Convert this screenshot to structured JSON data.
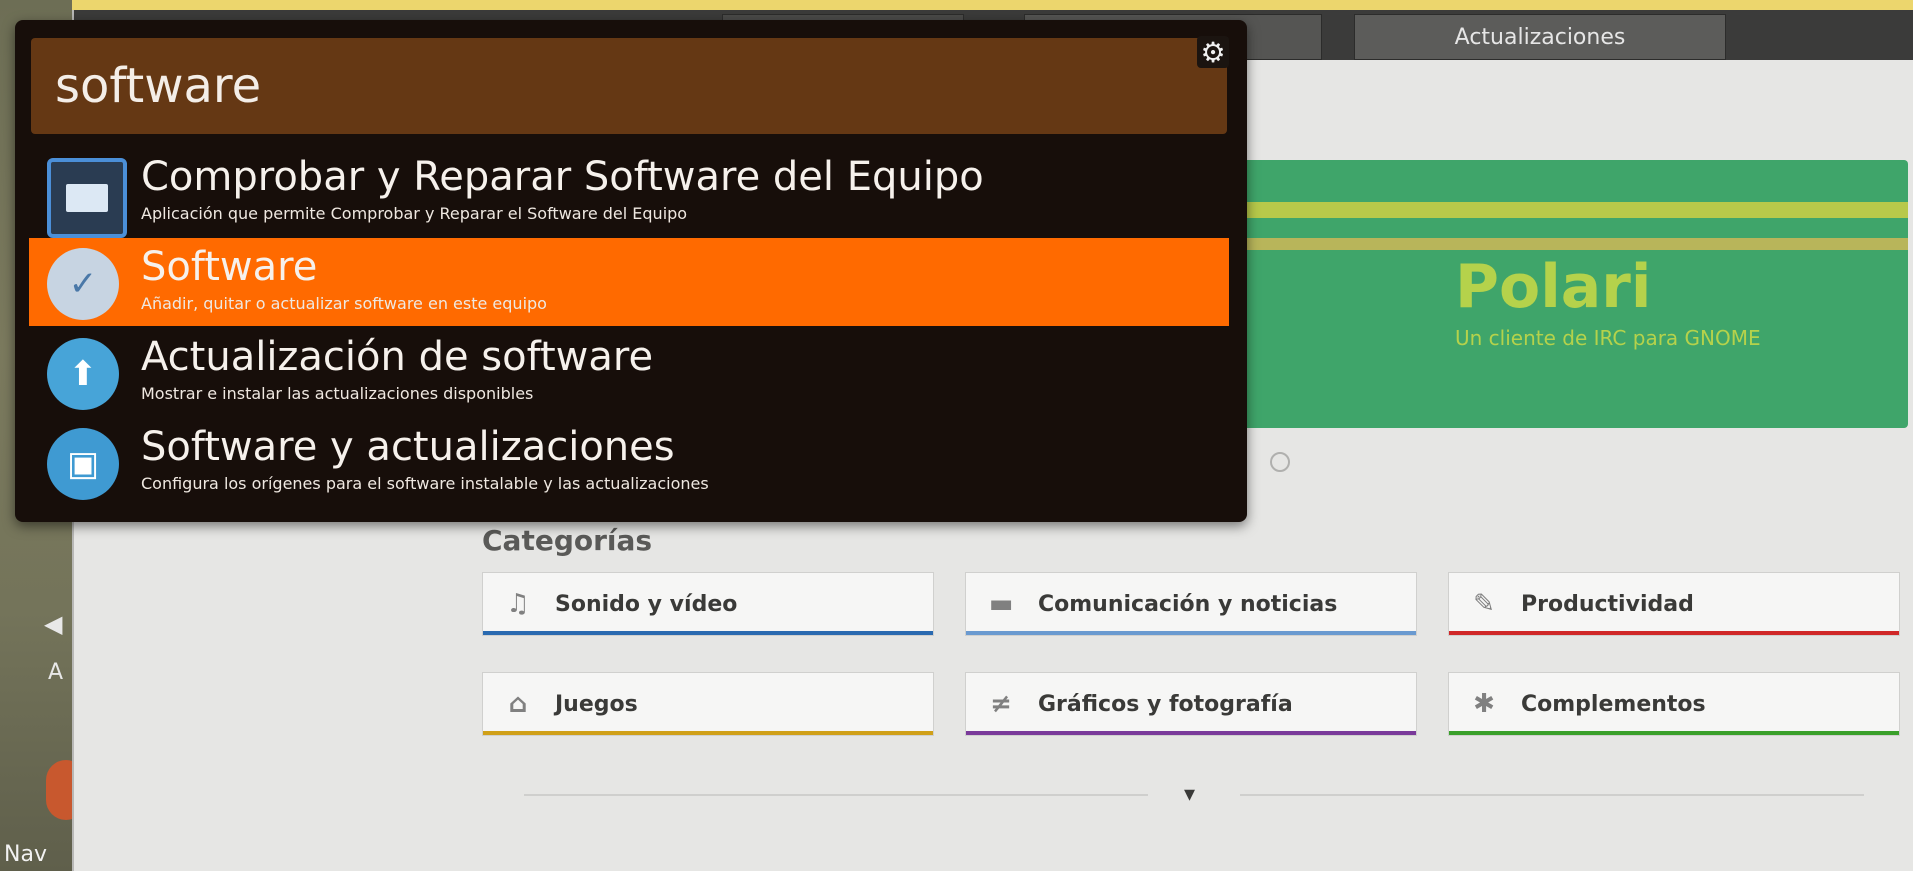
{
  "dash": {
    "search": {
      "value": "software",
      "settings_icon": "gear-icon"
    },
    "results": [
      {
        "title": "Comprobar y Reparar Software del Equipo",
        "description": "Aplicación que permite Comprobar y Reparar el Software del Equipo",
        "icon": "monitor-check-icon",
        "selected": false
      },
      {
        "title": "Software",
        "description": "Añadir, quitar o actualizar software en este equipo",
        "icon": "software-bag-icon",
        "selected": true
      },
      {
        "title": "Actualización de software",
        "description": "Mostrar e instalar las actualizaciones disponibles",
        "icon": "update-arrow-icon",
        "selected": false
      },
      {
        "title": "Software y actualizaciones",
        "description": "Configura los orígenes para el software instalable y las actualizaciones",
        "icon": "software-box-icon",
        "selected": false
      }
    ],
    "colors": {
      "background": "#170e0a",
      "search_background": "#653814",
      "selection": "#ff6a00"
    }
  },
  "window": {
    "tabs": [
      "Actualizaciones"
    ],
    "featured": {
      "title": "Polari",
      "subtitle": "Un cliente de IRC para GNOME",
      "color": "#3fa56a"
    },
    "categories_heading": "Categorías",
    "categories": [
      {
        "label": "Sonido y vídeo",
        "icon": "music-note-icon",
        "color": "#2a6ab0"
      },
      {
        "label": "Comunicación y noticias",
        "icon": "chat-bubble-icon",
        "color": "#6a9ad0"
      },
      {
        "label": "Productividad",
        "icon": "edit-icon",
        "color": "#d02828"
      },
      {
        "label": "Juegos",
        "icon": "gamepad-icon",
        "color": "#d0a018"
      },
      {
        "label": "Gráficos y fotografía",
        "icon": "brush-icon",
        "color": "#7a3a9a"
      },
      {
        "label": "Complementos",
        "icon": "puzzle-icon",
        "color": "#3aa02a"
      }
    ],
    "more_icon": "chevron-down-icon"
  },
  "desktop": {
    "label_fragment": "Nav"
  }
}
